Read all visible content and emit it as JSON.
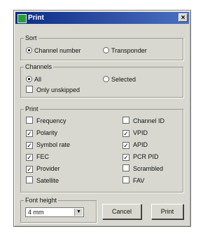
{
  "window": {
    "title": "Print",
    "close_glyph": "×"
  },
  "sort": {
    "legend": "Sort",
    "options": [
      {
        "label": "Channel number",
        "selected": true
      },
      {
        "label": "Transponder",
        "selected": false
      }
    ]
  },
  "channels": {
    "legend": "Channels",
    "options": [
      {
        "label": "All",
        "selected": true
      },
      {
        "label": "Selected",
        "selected": false
      }
    ],
    "only_unskipped": {
      "label": "Only unskipped",
      "checked": false
    }
  },
  "print": {
    "legend": "Print",
    "left": [
      {
        "label": "Frequency",
        "checked": false
      },
      {
        "label": "Polarity",
        "checked": true
      },
      {
        "label": "Symbol rate",
        "checked": true
      },
      {
        "label": "FEC",
        "checked": true
      },
      {
        "label": "Provider",
        "checked": true
      },
      {
        "label": "Satellite",
        "checked": false
      }
    ],
    "right": [
      {
        "label": "Channel ID",
        "checked": false
      },
      {
        "label": "VPID",
        "checked": true
      },
      {
        "label": "APID",
        "checked": true
      },
      {
        "label": "PCR PID",
        "checked": true
      },
      {
        "label": "Scrambled",
        "checked": false
      },
      {
        "label": "FAV",
        "checked": false
      }
    ]
  },
  "font_height": {
    "legend": "Font height",
    "value": "4 mm"
  },
  "buttons": {
    "cancel": "Cancel",
    "print": "Print"
  },
  "colors": {
    "titlebar_start": "#0b2d86",
    "titlebar_end": "#4b6fc0",
    "dialog_bg": "#d8d8d0"
  }
}
